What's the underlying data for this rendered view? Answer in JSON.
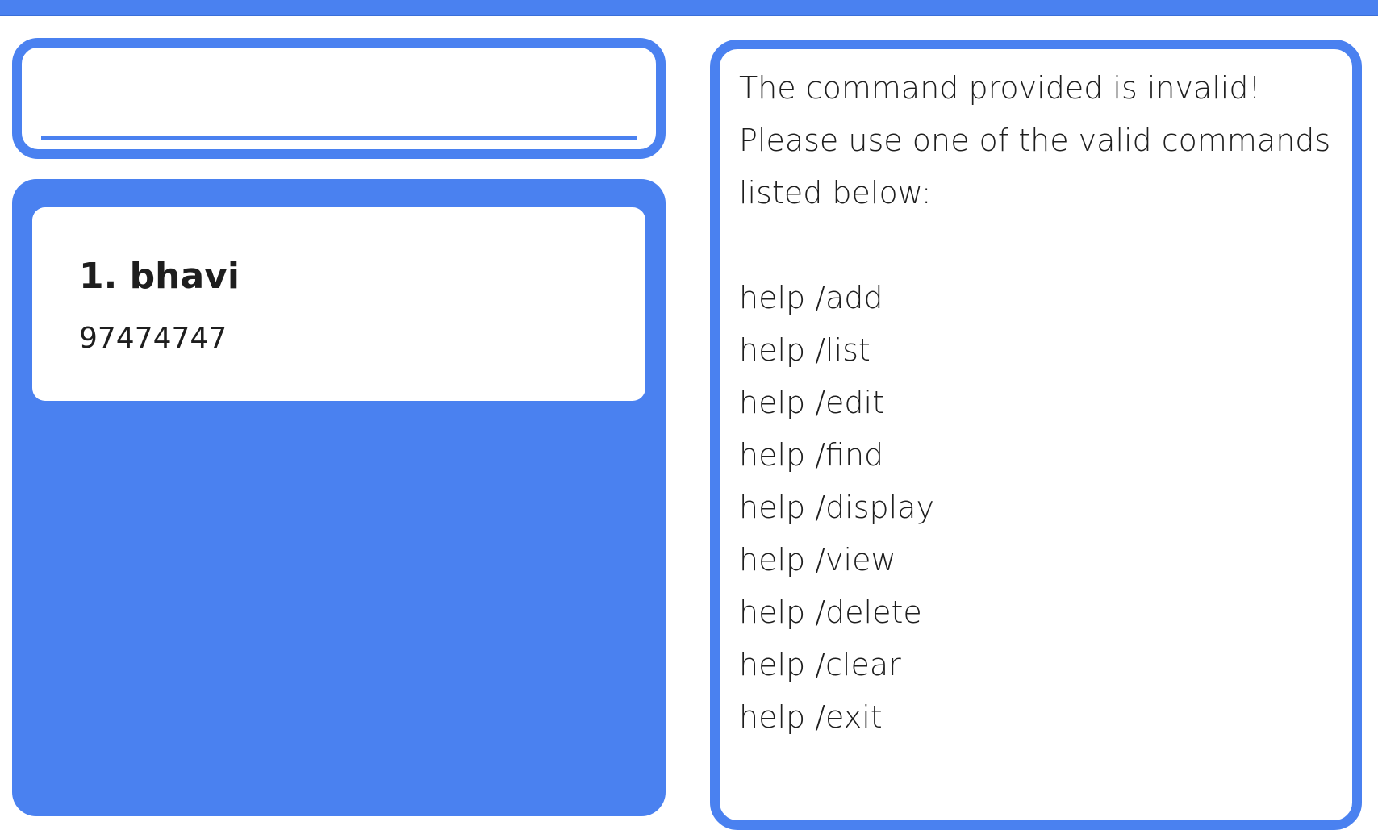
{
  "command_box": {
    "input_value": ""
  },
  "contacts": [
    {
      "name": "1. bhavi",
      "phone": "97474747"
    }
  ],
  "result_display": {
    "message_lines": [
      "The command provided is invalid!",
      "Please use one of the valid commands",
      "listed below:"
    ],
    "commands": [
      "help /add",
      "help /list",
      "help /edit",
      "help /find",
      "help /display",
      "help /view",
      "help /delete",
      "help /clear",
      "help /exit"
    ]
  },
  "colors": {
    "accent": "#4a81f0",
    "text": "#1e1e1e",
    "background": "#ffffff"
  }
}
